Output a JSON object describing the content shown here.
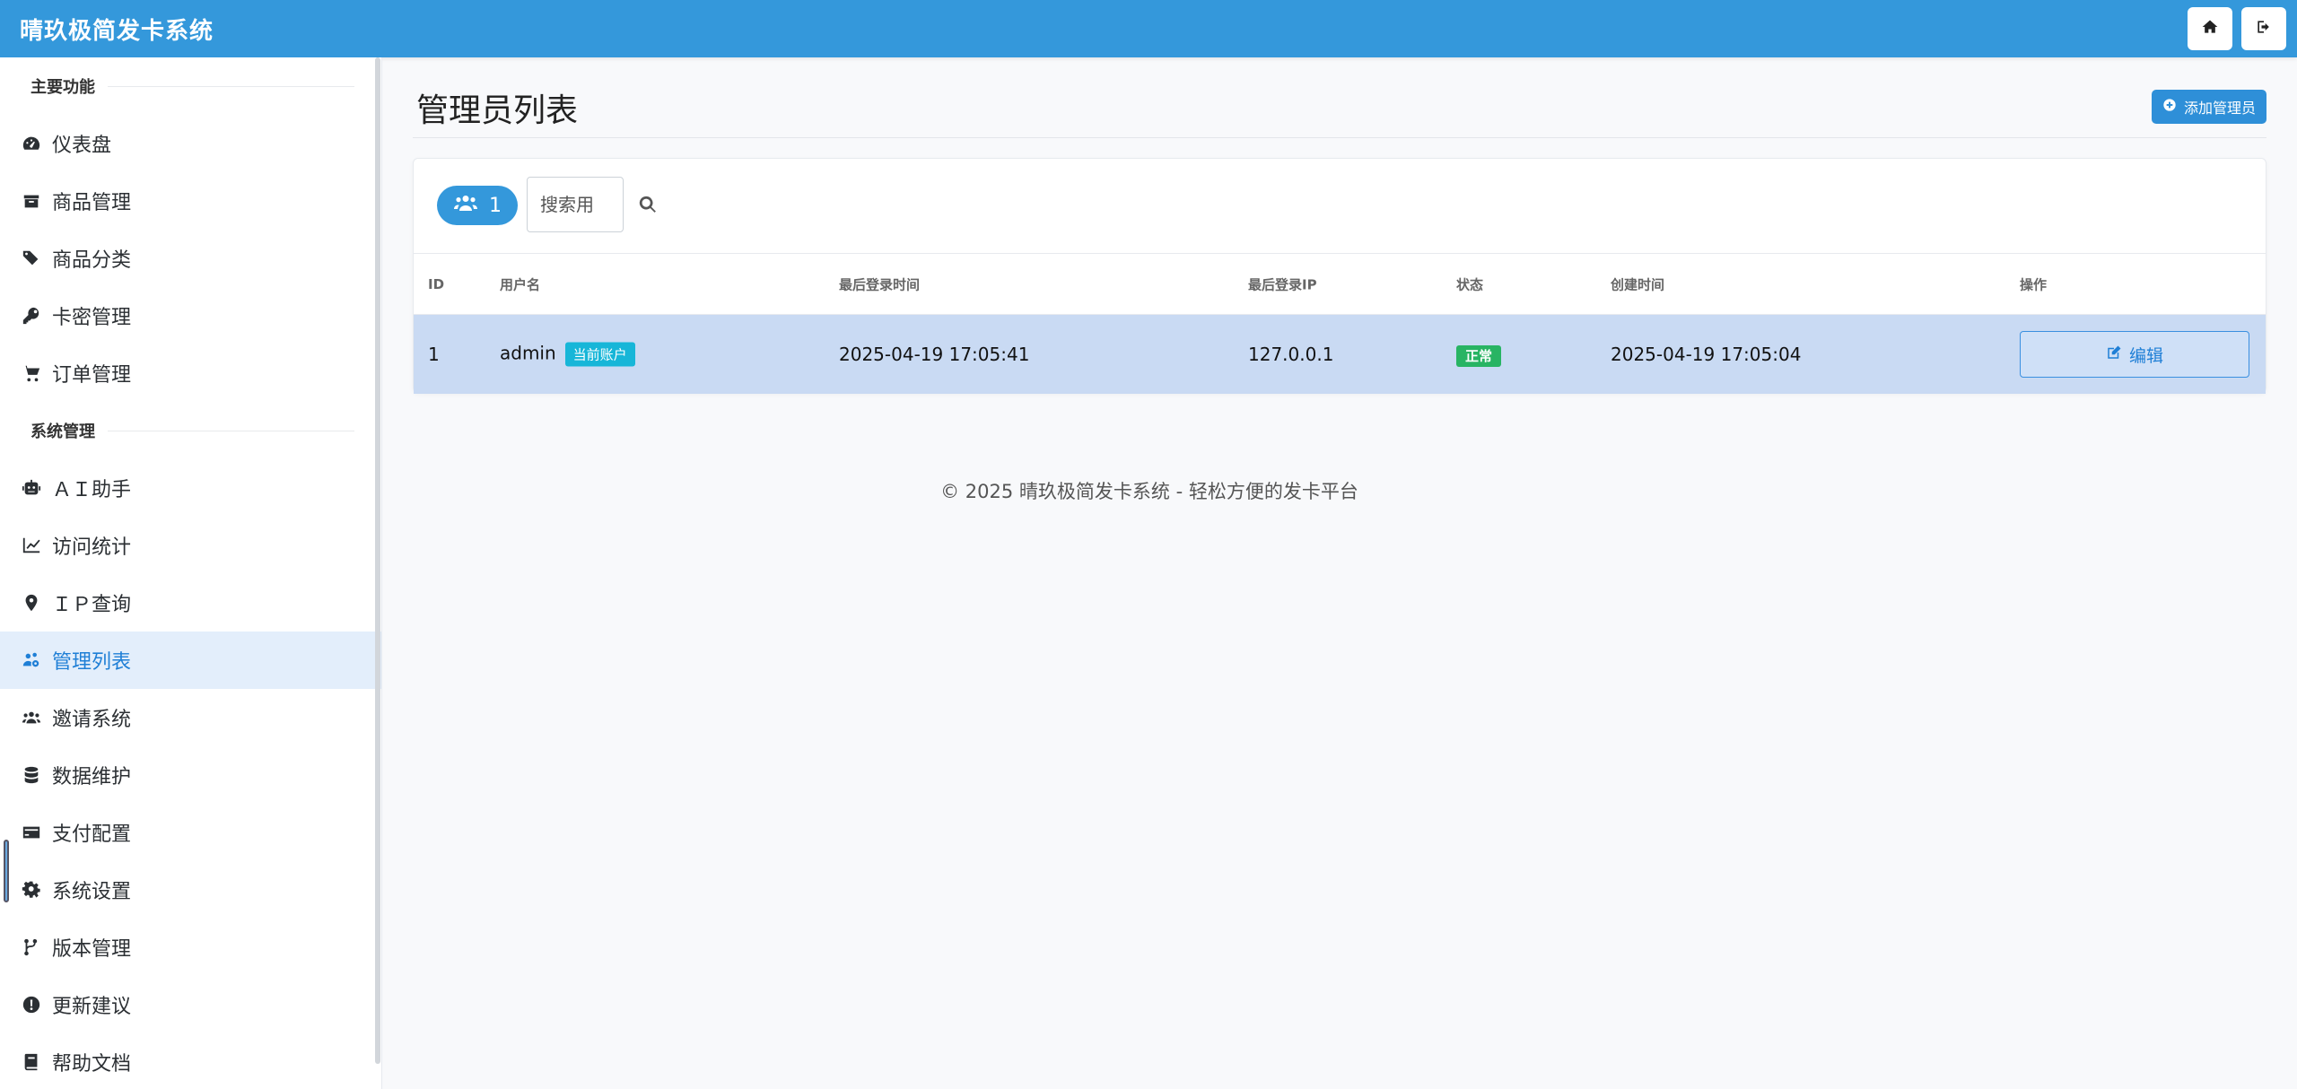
{
  "app": {
    "brand": "晴玖极简发卡系统",
    "home_icon": "home-icon",
    "logout_icon": "sign-out-icon"
  },
  "sidebar": {
    "sections": [
      {
        "title": "主要功能",
        "items": [
          {
            "label": "仪表盘",
            "icon": "dashboard-icon"
          },
          {
            "label": "商品管理",
            "icon": "box-icon"
          },
          {
            "label": "商品分类",
            "icon": "tags-icon"
          },
          {
            "label": "卡密管理",
            "icon": "key-icon"
          },
          {
            "label": "订单管理",
            "icon": "cart-icon"
          }
        ]
      },
      {
        "title": "系统管理",
        "items": [
          {
            "label": "ＡＩ助手",
            "icon": "robot-icon"
          },
          {
            "label": "访问统计",
            "icon": "chart-line-icon"
          },
          {
            "label": "ＩＰ查询",
            "icon": "map-marker-icon"
          },
          {
            "label": "管理列表",
            "icon": "users-cog-icon",
            "active": true
          },
          {
            "label": "邀请系统",
            "icon": "users-icon"
          },
          {
            "label": "数据维护",
            "icon": "database-icon"
          },
          {
            "label": "支付配置",
            "icon": "credit-card-icon"
          },
          {
            "label": "系统设置",
            "icon": "gear-icon"
          },
          {
            "label": "版本管理",
            "icon": "code-branch-icon"
          },
          {
            "label": "更新建议",
            "icon": "exclamation-circle-icon"
          },
          {
            "label": "帮助文档",
            "icon": "book-icon"
          }
        ]
      }
    ]
  },
  "page": {
    "title": "管理员列表",
    "add_button": "添加管理员"
  },
  "toolbar": {
    "count": "1",
    "search_placeholder": "搜索用"
  },
  "table": {
    "headers": [
      "ID",
      "用户名",
      "最后登录时间",
      "最后登录IP",
      "状态",
      "创建时间",
      "操作"
    ],
    "rows": [
      {
        "id": "1",
        "username": "admin",
        "current_badge": "当前账户",
        "last_login_time": "2025-04-19 17:05:41",
        "last_login_ip": "127.0.0.1",
        "status": "正常",
        "created_at": "2025-04-19 17:05:04",
        "action": "编辑"
      }
    ]
  },
  "footer": {
    "text": "© 2025 晴玖极简发卡系统 - 轻松方便的发卡平台"
  },
  "colors": {
    "primary": "#3498db",
    "active_row": "#c9daf3",
    "status_ok": "#28b463",
    "badge_current": "#17b6d8"
  }
}
